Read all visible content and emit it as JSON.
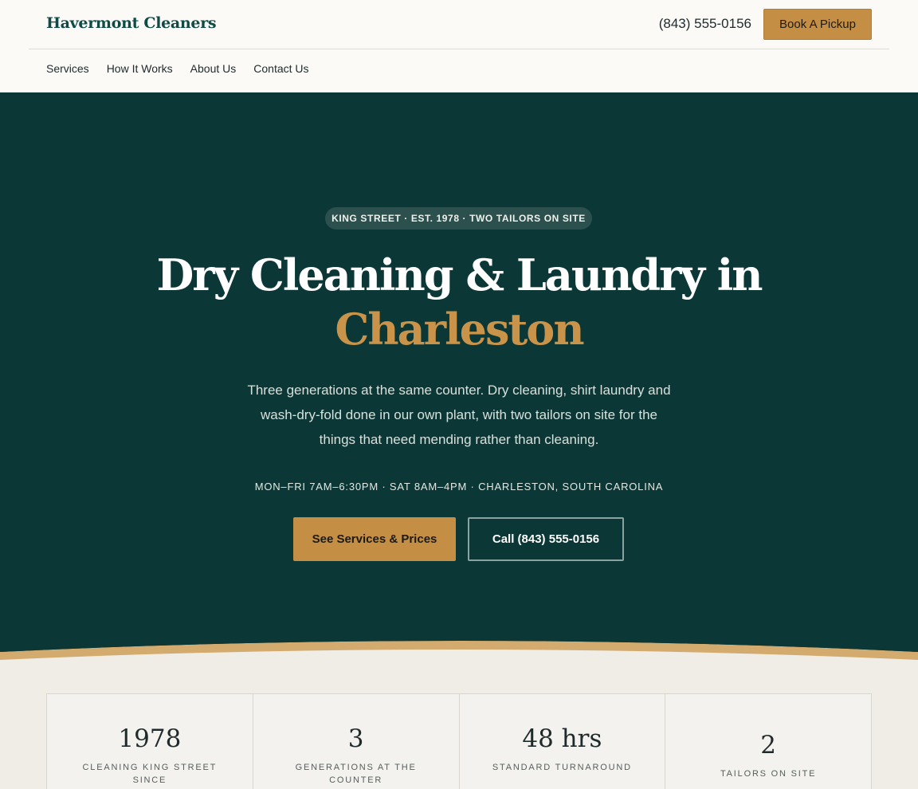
{
  "header": {
    "logo": "Havermont Cleaners",
    "phone": "(843) 555-0156",
    "book_label": "Book A Pickup"
  },
  "nav": {
    "items": [
      {
        "label": "Services"
      },
      {
        "label": "How It Works"
      },
      {
        "label": "About Us"
      },
      {
        "label": "Contact Us"
      }
    ]
  },
  "hero": {
    "badge": "KING STREET · EST. 1978 · TWO TAILORS ON SITE",
    "title_line1": "Dry Cleaning & Laundry in",
    "title_line2": "Charleston",
    "lead": "Three generations at the same counter. Dry cleaning, shirt laundry and wash-dry-fold done in our own plant, with two tailors on site for the things that need mending rather than cleaning.",
    "hours": "MON–FRI 7AM–6:30PM · SAT 8AM–4PM · CHARLESTON, SOUTH CAROLINA",
    "primary_cta": "See Services & Prices",
    "secondary_cta": "Call (843) 555-0156"
  },
  "stats": [
    {
      "value": "1978",
      "label": "CLEANING KING STREET SINCE"
    },
    {
      "value": "3",
      "label": "GENERATIONS AT THE COUNTER"
    },
    {
      "value": "48 hrs",
      "label": "STANDARD TURNAROUND"
    },
    {
      "value": "2",
      "label": "TAILORS ON SITE"
    }
  ],
  "colors": {
    "hero_bg": "#0b3736",
    "accent": "#c48f44",
    "brand": "#0f4a44",
    "page_bg": "#efede6"
  }
}
